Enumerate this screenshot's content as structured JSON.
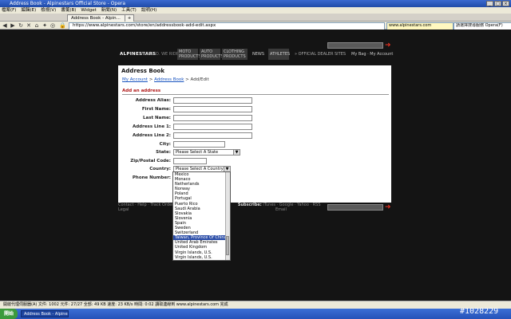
{
  "browser": {
    "title": "Address Book - Alpinestars Official Store - Opera",
    "menu": [
      "檔案(F)",
      "編輯(E)",
      "檢視(V)",
      "書籤(B)",
      "Widget",
      "新聞(N)",
      "工具(T)",
      "說明(H)"
    ],
    "tab_label": "Address Book - Alpin...",
    "address_url": "https://www.alpinestars.com/store/en/addressbook-add-edit.aspx",
    "address_secondary": "www.alpinestars.com",
    "search_engine": "請選擇搜尋服務 Opera(F)"
  },
  "site": {
    "logo": "ALPINESTARS",
    "tagline": "WE BUILD. WE RIDE",
    "nav": [
      "MOTO PRODUCTS",
      "AUTO PRODUCTS",
      "CLOTHING PRODUCTS",
      "NEWS",
      "ATHLETES"
    ],
    "dealer_link": "» OFFICIAL DEALER SITES",
    "user_links": "My Bag · My Account"
  },
  "page": {
    "title": "Address Book",
    "breadcrumb": {
      "my_account": "My Account",
      "address_book": "Address Book",
      "current": "> Add/Edit"
    },
    "section_title": "Add an address",
    "labels": {
      "alias": "Address Alias:",
      "first": "First Name:",
      "last": "Last Name:",
      "line1": "Address Line 1:",
      "line2": "Address Line 2:",
      "city": "City:",
      "state": "State:",
      "zip": "Zip/Postal Code:",
      "country": "Country:",
      "phone": "Phone Number:"
    },
    "state_value": "Please Select A State",
    "country_value": "Please Select A Country"
  },
  "country_dropdown": {
    "options": [
      "Mexico",
      "Monaco",
      "Netherlands",
      "Norway",
      "Poland",
      "Portugal",
      "Puerto Rico",
      "Saudi Arabia",
      "Slovakia",
      "Slovenia",
      "Spain",
      "Sweden",
      "Switzerland",
      "Taiwan, Province Of China",
      "United Arab Emirates",
      "United Kingdom",
      "Virgin Islands, U.S.",
      "Virgin Islands, U.S."
    ],
    "selected_index": 13
  },
  "footer": {
    "links": "Contact · Help · Track Order",
    "subscribe_label": "Subscribe:",
    "subscribe_links": "iTunes · Google · Yahoo · RSS",
    "line2_left": "Legal",
    "line2_right": "Email"
  },
  "status": {
    "text": "開啟代理伺服器(A)  文件: 1002  元件: 27/27  全部: 49 KB  速度: 23 KB/s  時間: 0:02  讀取連線到 www.alpinestars.com 完成"
  },
  "taskbar": {
    "start": "開始",
    "item": "Address Book - Alpinesta..."
  },
  "watermark": "#1028229"
}
